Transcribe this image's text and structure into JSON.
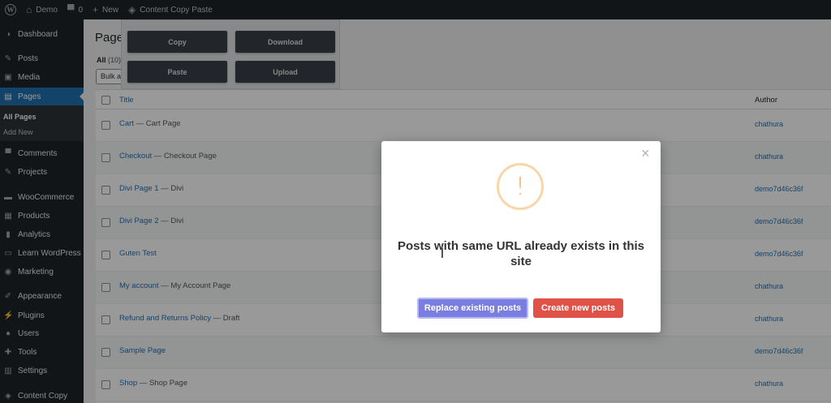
{
  "adminbar": {
    "site_name": "Demo",
    "comments_count": "0",
    "new_label": "New",
    "plugin_label": "Content Copy Paste"
  },
  "sidebar": {
    "items": [
      {
        "label": "Dashboard",
        "icon": "dashboard-icon"
      },
      {
        "label": "Posts",
        "icon": "pin-icon"
      },
      {
        "label": "Media",
        "icon": "media-icon"
      },
      {
        "label": "Pages",
        "icon": "pages-icon"
      },
      {
        "label": "Comments",
        "icon": "comments-icon"
      },
      {
        "label": "Projects",
        "icon": "pin-icon"
      },
      {
        "label": "WooCommerce",
        "icon": "woocommerce-icon"
      },
      {
        "label": "Products",
        "icon": "products-icon"
      },
      {
        "label": "Analytics",
        "icon": "analytics-icon"
      },
      {
        "label": "Learn WordPress",
        "icon": "learn-icon"
      },
      {
        "label": "Marketing",
        "icon": "marketing-icon"
      },
      {
        "label": "Appearance",
        "icon": "appearance-icon"
      },
      {
        "label": "Plugins",
        "icon": "plugins-icon"
      },
      {
        "label": "Users",
        "icon": "users-icon"
      },
      {
        "label": "Tools",
        "icon": "tools-icon"
      },
      {
        "label": "Settings",
        "icon": "settings-icon"
      },
      {
        "label": "Content Copy",
        "icon": "content-copy-icon"
      }
    ],
    "submenu": [
      "All Pages",
      "Add New"
    ]
  },
  "main": {
    "heading": "Page",
    "filter_all": "All",
    "filter_count": "(10)",
    "bulk_actions": "Bulk a"
  },
  "ccp_panel": {
    "copy": "Copy",
    "download": "Download",
    "paste": "Paste",
    "upload": "Upload"
  },
  "table": {
    "col_title": "Title",
    "col_author": "Author",
    "rows": [
      {
        "title": "Cart",
        "state": " — Cart Page",
        "author": "chathura"
      },
      {
        "title": "Checkout",
        "state": " — Checkout Page",
        "author": "chathura"
      },
      {
        "title": "Divi Page 1",
        "state": " — Divi",
        "author": "demo7d46c36f"
      },
      {
        "title": "Divi Page 2",
        "state": " — Divi",
        "author": "demo7d46c36f"
      },
      {
        "title": "Guten Test",
        "state": "",
        "author": "demo7d46c36f"
      },
      {
        "title": "My account",
        "state": " — My Account Page",
        "author": "chathura"
      },
      {
        "title": "Refund and Returns Policy",
        "state": " — Draft",
        "author": "chathura"
      },
      {
        "title": "Sample Page",
        "state": "",
        "author": "demo7d46c36f"
      },
      {
        "title": "Shop",
        "state": " — Shop Page",
        "author": "chathura"
      }
    ]
  },
  "modal": {
    "icon_glyph": "!",
    "close_glyph": "×",
    "title": "Posts with same URL already exists in this site",
    "replace_label": "Replace existing posts",
    "create_label": "Create new posts"
  }
}
